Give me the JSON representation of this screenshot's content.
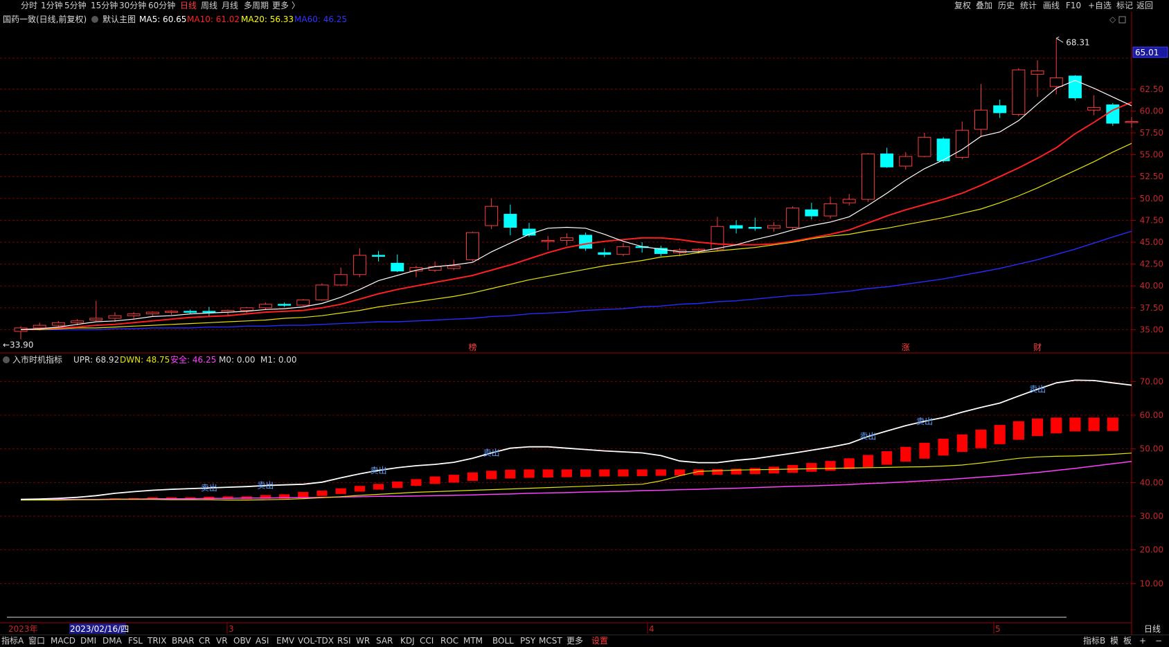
{
  "menu": {
    "periods": [
      "分时",
      "1分钟",
      "5分钟",
      "15分钟",
      "30分钟",
      "60分钟",
      "日线",
      "周线",
      "月线",
      "多周期",
      "更多 〉"
    ],
    "active_period": "日线",
    "tools": [
      "复权",
      "叠加",
      "历史",
      "统计",
      "画线",
      "F10",
      "+自选",
      "标记",
      "返回"
    ]
  },
  "main_legend": {
    "stock": "国药一致(日线,前复权)",
    "chart_name": "默认主图",
    "ma5": "MA5: 60.65",
    "ma10": "MA10: 61.02",
    "ma20": "MA20: 56.33",
    "ma60": "MA60: 46.25"
  },
  "sub_legend": {
    "name": "入市时机指标",
    "upr": "UPR: 68.92",
    "dwn": "DWN: 48.75",
    "safe": "安全: 46.25",
    "m0": "M0: 0.00",
    "m1": "M1: 0.00"
  },
  "annotations": {
    "high": "68.31",
    "low": "33.90",
    "last_price": "65.01",
    "markers": [
      "榜",
      "涨",
      "财"
    ],
    "sell_signal": "卖出"
  },
  "x_axis": {
    "labels": [
      "2023年",
      "2023/02/16/四",
      "3",
      "4",
      "5"
    ],
    "period_label": "日线"
  },
  "bottom_tabs": [
    "指标A",
    "窗口",
    "MACD",
    "DMI",
    "DMA",
    "FSL",
    "TRIX",
    "BRAR",
    "CR",
    "VR",
    "OBV",
    "ASI",
    "EMV",
    "VOL-TDX",
    "RSI",
    "WR",
    "SAR",
    "KDJ",
    "CCI",
    "ROC",
    "MTM",
    "BOLL",
    "PSY",
    "MCST",
    "更多",
    "设置"
  ],
  "bottom_right": [
    "指标B",
    "模",
    "板",
    "+",
    "−"
  ],
  "colors": {
    "up": "#ff3c3c",
    "down": "#00ffff",
    "ma5": "#ffffff",
    "ma10": "#ff2020",
    "ma20": "#e6e600",
    "ma60": "#2a2aff",
    "safe": "#ff40ff",
    "bar": "#ff0000",
    "grid": "#7a0000"
  },
  "chart_data": [
    {
      "type": "candlestick",
      "title": "国药一致(日线,前复权)",
      "y_ticks": [
        35.0,
        37.5,
        40.0,
        42.5,
        45.0,
        47.5,
        50.0,
        52.5,
        55.0,
        57.5,
        60.0,
        62.5
      ],
      "ylim": [
        32.5,
        70.0
      ],
      "candles": [
        {
          "o": 34.8,
          "h": 35.4,
          "l": 33.9,
          "c": 35.2
        },
        {
          "o": 35.2,
          "h": 35.8,
          "l": 34.9,
          "c": 35.5
        },
        {
          "o": 35.5,
          "h": 36.0,
          "l": 35.1,
          "c": 35.8
        },
        {
          "o": 35.8,
          "h": 36.2,
          "l": 35.5,
          "c": 36.0
        },
        {
          "o": 36.1,
          "h": 38.3,
          "l": 36.0,
          "c": 36.3
        },
        {
          "o": 36.3,
          "h": 37.0,
          "l": 35.9,
          "c": 36.6
        },
        {
          "o": 36.6,
          "h": 37.0,
          "l": 36.2,
          "c": 36.8
        },
        {
          "o": 36.8,
          "h": 37.1,
          "l": 36.5,
          "c": 37.0
        },
        {
          "o": 37.0,
          "h": 37.2,
          "l": 36.7,
          "c": 37.1
        },
        {
          "o": 37.1,
          "h": 37.3,
          "l": 36.8,
          "c": 37.0
        },
        {
          "o": 37.1,
          "h": 37.6,
          "l": 36.5,
          "c": 37.0
        },
        {
          "o": 37.0,
          "h": 37.3,
          "l": 36.6,
          "c": 37.2
        },
        {
          "o": 37.2,
          "h": 37.6,
          "l": 36.9,
          "c": 37.5
        },
        {
          "o": 37.5,
          "h": 38.1,
          "l": 37.3,
          "c": 37.9
        },
        {
          "o": 37.9,
          "h": 38.1,
          "l": 37.6,
          "c": 37.8
        },
        {
          "o": 37.8,
          "h": 38.5,
          "l": 37.7,
          "c": 38.4
        },
        {
          "o": 38.4,
          "h": 40.3,
          "l": 38.3,
          "c": 40.1
        },
        {
          "o": 40.1,
          "h": 42.1,
          "l": 40.0,
          "c": 41.3
        },
        {
          "o": 41.3,
          "h": 44.3,
          "l": 41.0,
          "c": 43.5
        },
        {
          "o": 43.5,
          "h": 44.0,
          "l": 42.8,
          "c": 43.4
        },
        {
          "o": 42.6,
          "h": 43.6,
          "l": 41.6,
          "c": 41.7
        },
        {
          "o": 41.7,
          "h": 42.3,
          "l": 41.0,
          "c": 42.1
        },
        {
          "o": 41.8,
          "h": 42.8,
          "l": 41.6,
          "c": 42.2
        },
        {
          "o": 42.0,
          "h": 43.0,
          "l": 41.8,
          "c": 42.3
        },
        {
          "o": 43.0,
          "h": 46.2,
          "l": 42.8,
          "c": 46.1
        },
        {
          "o": 46.9,
          "h": 50.0,
          "l": 46.5,
          "c": 49.1
        },
        {
          "o": 48.2,
          "h": 49.3,
          "l": 45.8,
          "c": 46.7
        },
        {
          "o": 46.5,
          "h": 47.2,
          "l": 45.6,
          "c": 45.8
        },
        {
          "o": 45.1,
          "h": 45.7,
          "l": 44.1,
          "c": 45.2
        },
        {
          "o": 45.2,
          "h": 46.0,
          "l": 44.6,
          "c": 45.5
        },
        {
          "o": 45.8,
          "h": 46.1,
          "l": 44.0,
          "c": 44.3
        },
        {
          "o": 43.8,
          "h": 44.3,
          "l": 43.3,
          "c": 43.6
        },
        {
          "o": 43.6,
          "h": 44.9,
          "l": 43.4,
          "c": 44.5
        },
        {
          "o": 44.5,
          "h": 45.0,
          "l": 43.8,
          "c": 44.4
        },
        {
          "o": 44.3,
          "h": 44.6,
          "l": 43.4,
          "c": 43.7
        },
        {
          "o": 43.8,
          "h": 44.3,
          "l": 43.4,
          "c": 44.1
        },
        {
          "o": 44.1,
          "h": 44.3,
          "l": 43.7,
          "c": 44.2
        },
        {
          "o": 44.2,
          "h": 47.9,
          "l": 44.0,
          "c": 46.8
        },
        {
          "o": 46.9,
          "h": 47.5,
          "l": 46.0,
          "c": 46.6
        },
        {
          "o": 46.7,
          "h": 47.8,
          "l": 46.3,
          "c": 46.6
        },
        {
          "o": 46.6,
          "h": 47.3,
          "l": 46.2,
          "c": 46.9
        },
        {
          "o": 46.7,
          "h": 49.1,
          "l": 46.4,
          "c": 48.9
        },
        {
          "o": 48.7,
          "h": 49.5,
          "l": 47.6,
          "c": 48.0
        },
        {
          "o": 48.0,
          "h": 50.2,
          "l": 47.7,
          "c": 49.4
        },
        {
          "o": 49.5,
          "h": 50.5,
          "l": 49.2,
          "c": 49.9
        },
        {
          "o": 49.9,
          "h": 55.2,
          "l": 49.6,
          "c": 55.1
        },
        {
          "o": 55.1,
          "h": 55.8,
          "l": 53.5,
          "c": 53.6
        },
        {
          "o": 53.7,
          "h": 55.3,
          "l": 53.3,
          "c": 54.8
        },
        {
          "o": 54.8,
          "h": 57.5,
          "l": 54.7,
          "c": 57.0
        },
        {
          "o": 56.8,
          "h": 57.0,
          "l": 54.1,
          "c": 54.3
        },
        {
          "o": 54.7,
          "h": 58.8,
          "l": 54.5,
          "c": 57.8
        },
        {
          "o": 57.9,
          "h": 63.1,
          "l": 57.0,
          "c": 60.1
        },
        {
          "o": 60.6,
          "h": 61.3,
          "l": 59.2,
          "c": 59.8
        },
        {
          "o": 59.6,
          "h": 64.9,
          "l": 59.4,
          "c": 64.7
        },
        {
          "o": 64.2,
          "h": 65.8,
          "l": 61.6,
          "c": 64.6
        },
        {
          "o": 62.8,
          "h": 68.3,
          "l": 61.9,
          "c": 63.8
        },
        {
          "o": 64.0,
          "h": 64.1,
          "l": 61.2,
          "c": 61.5
        },
        {
          "o": 60.1,
          "h": 61.8,
          "l": 59.5,
          "c": 60.4
        },
        {
          "o": 60.7,
          "h": 60.9,
          "l": 58.3,
          "c": 58.6
        },
        {
          "o": 58.8,
          "h": 59.3,
          "l": 58.1,
          "c": 58.8
        }
      ],
      "ma5": [
        35.0,
        35.1,
        35.3,
        35.6,
        35.9,
        36.0,
        36.2,
        36.5,
        36.6,
        36.8,
        36.9,
        37.0,
        37.1,
        37.3,
        37.4,
        37.6,
        38.0,
        38.7,
        39.6,
        40.6,
        41.2,
        41.8,
        42.2,
        42.4,
        42.7,
        43.9,
        44.9,
        45.9,
        46.6,
        46.7,
        46.6,
        45.9,
        45.1,
        44.5,
        44.2,
        43.9,
        43.9,
        44.3,
        44.7,
        45.3,
        45.8,
        46.4,
        46.9,
        47.3,
        47.9,
        49.2,
        50.6,
        52.1,
        53.4,
        54.4,
        55.6,
        57.1,
        57.6,
        58.9,
        60.8,
        62.6,
        63.5,
        62.6,
        61.6,
        60.6
      ],
      "ma10": [
        35.0,
        35.1,
        35.2,
        35.3,
        35.5,
        35.6,
        35.8,
        36.0,
        36.2,
        36.4,
        36.5,
        36.6,
        36.8,
        37.0,
        37.1,
        37.2,
        37.5,
        37.9,
        38.5,
        39.1,
        39.6,
        40.0,
        40.4,
        40.8,
        41.2,
        41.8,
        42.4,
        43.1,
        43.8,
        44.4,
        44.8,
        45.1,
        45.3,
        45.5,
        45.5,
        45.3,
        45.0,
        44.8,
        44.7,
        44.7,
        44.8,
        45.1,
        45.5,
        45.9,
        46.4,
        47.2,
        48.0,
        48.7,
        49.3,
        49.9,
        50.6,
        51.5,
        52.5,
        53.5,
        54.6,
        55.8,
        57.4,
        58.7,
        60.1,
        61.0
      ],
      "ma20": [
        35.0,
        35.0,
        35.1,
        35.2,
        35.2,
        35.3,
        35.4,
        35.5,
        35.6,
        35.7,
        35.8,
        35.9,
        36.0,
        36.1,
        36.3,
        36.4,
        36.6,
        36.9,
        37.2,
        37.6,
        37.9,
        38.2,
        38.5,
        38.8,
        39.2,
        39.7,
        40.2,
        40.7,
        41.1,
        41.5,
        41.9,
        42.3,
        42.6,
        42.9,
        43.3,
        43.5,
        43.8,
        44.0,
        44.2,
        44.4,
        44.7,
        45.0,
        45.4,
        45.7,
        45.9,
        46.3,
        46.6,
        47.0,
        47.4,
        47.8,
        48.3,
        48.8,
        49.5,
        50.3,
        51.2,
        52.2,
        53.2,
        54.2,
        55.3,
        56.3
      ],
      "ma60": [
        35.0,
        35.0,
        35.0,
        35.0,
        35.0,
        35.1,
        35.1,
        35.2,
        35.2,
        35.2,
        35.3,
        35.3,
        35.4,
        35.4,
        35.5,
        35.5,
        35.6,
        35.7,
        35.8,
        35.9,
        35.9,
        36.0,
        36.1,
        36.2,
        36.3,
        36.5,
        36.6,
        36.8,
        36.9,
        37.0,
        37.2,
        37.3,
        37.4,
        37.6,
        37.7,
        37.9,
        38.0,
        38.2,
        38.3,
        38.5,
        38.7,
        38.9,
        39.0,
        39.2,
        39.4,
        39.7,
        39.9,
        40.2,
        40.5,
        40.8,
        41.2,
        41.6,
        42.0,
        42.5,
        43.0,
        43.6,
        44.2,
        44.9,
        45.6,
        46.25
      ]
    },
    {
      "type": "line",
      "title": "入市时机指标",
      "y_ticks": [
        10.0,
        20.0,
        30.0,
        40.0,
        50.0,
        60.0,
        70.0
      ],
      "ylim": [
        0,
        75
      ],
      "upr": [
        35.0,
        35.1,
        35.3,
        35.6,
        36.1,
        36.8,
        37.3,
        37.7,
        38.0,
        38.2,
        38.4,
        38.6,
        38.8,
        39.1,
        39.3,
        39.5,
        40.1,
        41.4,
        42.6,
        43.6,
        44.4,
        45.0,
        45.4,
        46.0,
        47.2,
        48.8,
        50.2,
        50.6,
        50.6,
        50.2,
        49.8,
        49.4,
        49.1,
        48.8,
        48.0,
        46.4,
        45.9,
        45.9,
        46.6,
        47.1,
        47.9,
        48.7,
        49.6,
        50.5,
        51.6,
        53.7,
        55.3,
        56.9,
        58.2,
        59.3,
        60.9,
        62.3,
        63.6,
        65.7,
        67.7,
        69.6,
        70.4,
        70.3,
        69.6,
        68.92
      ],
      "dwn": [
        34.8,
        34.8,
        34.8,
        34.9,
        34.9,
        35.0,
        35.0,
        35.0,
        34.9,
        34.9,
        34.9,
        34.8,
        34.8,
        34.9,
        35.0,
        35.2,
        35.5,
        35.8,
        36.2,
        36.5,
        36.8,
        37.1,
        37.3,
        37.5,
        37.7,
        37.9,
        38.1,
        38.3,
        38.5,
        38.7,
        38.9,
        39.1,
        39.3,
        39.5,
        40.5,
        42.0,
        43.3,
        43.5,
        43.7,
        43.8,
        43.9,
        44.0,
        44.1,
        44.2,
        44.3,
        44.4,
        44.5,
        44.6,
        44.7,
        44.9,
        45.2,
        45.8,
        46.5,
        47.2,
        47.6,
        47.8,
        47.9,
        48.1,
        48.4,
        48.75
      ],
      "safe": [
        35.0,
        35.0,
        35.0,
        35.0,
        35.0,
        35.1,
        35.1,
        35.2,
        35.2,
        35.2,
        35.3,
        35.3,
        35.4,
        35.4,
        35.5,
        35.5,
        35.6,
        35.7,
        35.8,
        35.9,
        35.9,
        36.0,
        36.1,
        36.2,
        36.3,
        36.5,
        36.6,
        36.8,
        36.9,
        37.0,
        37.2,
        37.3,
        37.4,
        37.6,
        37.7,
        37.9,
        38.0,
        38.2,
        38.3,
        38.5,
        38.7,
        38.9,
        39.0,
        39.2,
        39.4,
        39.7,
        39.9,
        40.2,
        40.5,
        40.8,
        41.2,
        41.6,
        42.0,
        42.5,
        43.0,
        43.6,
        44.2,
        44.9,
        45.6,
        46.25
      ],
      "bars": [
        {
          "i": 5,
          "lo": 35.0,
          "hi": 35.3
        },
        {
          "i": 6,
          "lo": 35.0,
          "hi": 35.4
        },
        {
          "i": 7,
          "lo": 35.0,
          "hi": 35.6
        },
        {
          "i": 8,
          "lo": 35.0,
          "hi": 35.6
        },
        {
          "i": 9,
          "lo": 35.0,
          "hi": 35.6
        },
        {
          "i": 10,
          "lo": 35.0,
          "hi": 35.8
        },
        {
          "i": 11,
          "lo": 35.1,
          "hi": 35.9
        },
        {
          "i": 12,
          "lo": 35.1,
          "hi": 35.9
        },
        {
          "i": 13,
          "lo": 35.2,
          "hi": 36.3
        },
        {
          "i": 14,
          "lo": 35.2,
          "hi": 36.5
        },
        {
          "i": 15,
          "lo": 35.6,
          "hi": 37.2
        },
        {
          "i": 16,
          "lo": 36.0,
          "hi": 37.6
        },
        {
          "i": 17,
          "lo": 36.6,
          "hi": 38.3
        },
        {
          "i": 18,
          "lo": 37.3,
          "hi": 39.0
        },
        {
          "i": 19,
          "lo": 37.9,
          "hi": 39.6
        },
        {
          "i": 20,
          "lo": 38.4,
          "hi": 40.3
        },
        {
          "i": 21,
          "lo": 39.0,
          "hi": 41.0
        },
        {
          "i": 22,
          "lo": 39.6,
          "hi": 41.8
        },
        {
          "i": 23,
          "lo": 40.0,
          "hi": 42.3
        },
        {
          "i": 24,
          "lo": 40.5,
          "hi": 43.0
        },
        {
          "i": 25,
          "lo": 41.0,
          "hi": 43.5
        },
        {
          "i": 26,
          "lo": 41.2,
          "hi": 43.8
        },
        {
          "i": 27,
          "lo": 41.4,
          "hi": 43.9
        },
        {
          "i": 28,
          "lo": 41.5,
          "hi": 43.9
        },
        {
          "i": 29,
          "lo": 41.6,
          "hi": 43.9
        },
        {
          "i": 30,
          "lo": 41.7,
          "hi": 43.9
        },
        {
          "i": 31,
          "lo": 41.8,
          "hi": 43.9
        },
        {
          "i": 32,
          "lo": 41.8,
          "hi": 43.9
        },
        {
          "i": 33,
          "lo": 41.9,
          "hi": 43.9
        },
        {
          "i": 34,
          "lo": 42.0,
          "hi": 43.9
        },
        {
          "i": 35,
          "lo": 42.1,
          "hi": 43.9
        },
        {
          "i": 36,
          "lo": 42.2,
          "hi": 43.9
        },
        {
          "i": 37,
          "lo": 42.3,
          "hi": 44.0
        },
        {
          "i": 38,
          "lo": 42.4,
          "hi": 44.1
        },
        {
          "i": 39,
          "lo": 42.5,
          "hi": 44.3
        },
        {
          "i": 40,
          "lo": 42.7,
          "hi": 44.7
        },
        {
          "i": 41,
          "lo": 42.9,
          "hi": 45.2
        },
        {
          "i": 42,
          "lo": 43.2,
          "hi": 45.8
        },
        {
          "i": 43,
          "lo": 43.5,
          "hi": 46.4
        },
        {
          "i": 44,
          "lo": 44.0,
          "hi": 47.2
        },
        {
          "i": 45,
          "lo": 44.6,
          "hi": 48.2
        },
        {
          "i": 46,
          "lo": 45.3,
          "hi": 49.3
        },
        {
          "i": 47,
          "lo": 46.2,
          "hi": 50.6
        },
        {
          "i": 48,
          "lo": 47.1,
          "hi": 51.8
        },
        {
          "i": 49,
          "lo": 48.0,
          "hi": 53.0
        },
        {
          "i": 50,
          "lo": 49.1,
          "hi": 54.3
        },
        {
          "i": 51,
          "lo": 50.2,
          "hi": 55.7
        },
        {
          "i": 52,
          "lo": 51.4,
          "hi": 57.1
        },
        {
          "i": 53,
          "lo": 52.7,
          "hi": 58.2
        },
        {
          "i": 54,
          "lo": 53.8,
          "hi": 59.0
        },
        {
          "i": 55,
          "lo": 54.6,
          "hi": 59.3
        },
        {
          "i": 56,
          "lo": 55.2,
          "hi": 59.3
        },
        {
          "i": 57,
          "lo": 55.3,
          "hi": 59.3
        },
        {
          "i": 58,
          "lo": 55.3,
          "hi": 59.3
        }
      ],
      "sell_points": [
        10,
        13,
        19,
        25,
        45,
        48,
        54
      ]
    }
  ]
}
